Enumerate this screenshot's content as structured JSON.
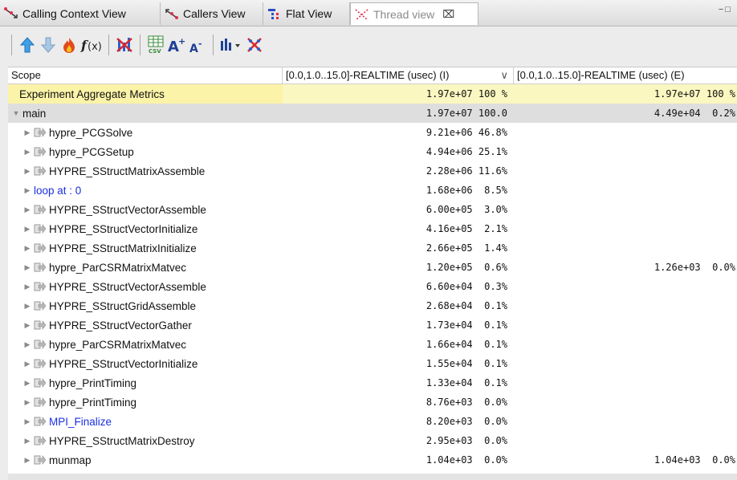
{
  "tabs": [
    {
      "label": "Calling Context View",
      "icon": "calling-context-icon"
    },
    {
      "label": "Callers View",
      "icon": "callers-icon"
    },
    {
      "label": "Flat View",
      "icon": "flat-view-icon"
    },
    {
      "label": "Thread view",
      "icon": "thread-view-icon",
      "close": "⌧"
    }
  ],
  "window_controls": "−□",
  "toolbar": [
    "zoom-in-arrow-icon",
    "zoom-out-arrow-icon",
    "hot-path-flame-icon",
    "derived-metric-fx-icon",
    "filter-metrics-icon",
    "csv-export-icon",
    "font-increase-icon",
    "font-decrease-icon",
    "graph-dropdown-icon",
    "thread-view-icon"
  ],
  "columns": {
    "scope": "Scope",
    "inclusive": "[0.0,1.0..15.0]-REALTIME (usec) (I)",
    "sort_indicator": "∨",
    "exclusive": "[0.0,1.0..15.0]-REALTIME (usec) (E)"
  },
  "rows": [
    {
      "scope": "Experiment Aggregate Metrics",
      "incl": "1.97e+07 100 %",
      "excl": "1.97e+07 100 %"
    },
    {
      "scope": "main",
      "incl": "1.97e+07 100.0",
      "excl": "4.49e+04  0.2%"
    },
    {
      "scope": "hypre_PCGSolve",
      "incl": "9.21e+06 46.8%",
      "excl": ""
    },
    {
      "scope": "hypre_PCGSetup",
      "incl": "4.94e+06 25.1%",
      "excl": ""
    },
    {
      "scope": "HYPRE_SStructMatrixAssemble",
      "incl": "2.28e+06 11.6%",
      "excl": ""
    },
    {
      "scope": "loop at : 0",
      "incl": "1.68e+06  8.5%",
      "excl": ""
    },
    {
      "scope": "HYPRE_SStructVectorAssemble",
      "incl": "6.00e+05  3.0%",
      "excl": ""
    },
    {
      "scope": "HYPRE_SStructVectorInitialize",
      "incl": "4.16e+05  2.1%",
      "excl": ""
    },
    {
      "scope": "HYPRE_SStructMatrixInitialize",
      "incl": "2.66e+05  1.4%",
      "excl": ""
    },
    {
      "scope": "hypre_ParCSRMatrixMatvec",
      "incl": "1.20e+05  0.6%",
      "excl": "1.26e+03  0.0%"
    },
    {
      "scope": "HYPRE_SStructVectorAssemble",
      "incl": "6.60e+04  0.3%",
      "excl": ""
    },
    {
      "scope": "HYPRE_SStructGridAssemble",
      "incl": "2.68e+04  0.1%",
      "excl": ""
    },
    {
      "scope": "HYPRE_SStructVectorGather",
      "incl": "1.73e+04  0.1%",
      "excl": ""
    },
    {
      "scope": "hypre_ParCSRMatrixMatvec",
      "incl": "1.66e+04  0.1%",
      "excl": ""
    },
    {
      "scope": "HYPRE_SStructVectorInitialize",
      "incl": "1.55e+04  0.1%",
      "excl": ""
    },
    {
      "scope": "hypre_PrintTiming",
      "incl": "1.33e+04  0.1%",
      "excl": ""
    },
    {
      "scope": "hypre_PrintTiming",
      "incl": "8.76e+03  0.0%",
      "excl": ""
    },
    {
      "scope": "MPI_Finalize",
      "incl": "8.20e+03  0.0%",
      "excl": ""
    },
    {
      "scope": "HYPRE_SStructMatrixDestroy",
      "incl": "2.95e+03  0.0%",
      "excl": ""
    },
    {
      "scope": "munmap",
      "incl": "1.04e+03  0.0%",
      "excl": "1.04e+03  0.0%"
    }
  ],
  "colors": {
    "aggregate_row": "#fbf7c0",
    "selected_main_row": "#dedede",
    "link_text": "#1a2fe0"
  }
}
